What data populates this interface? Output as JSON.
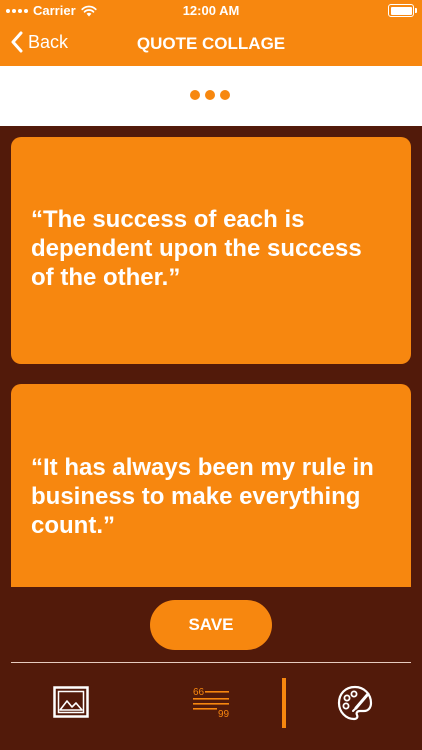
{
  "status_bar": {
    "carrier": "Carrier",
    "time": "12:00 AM"
  },
  "nav": {
    "back_label": "Back",
    "title": "QUOTE COLLAGE"
  },
  "quotes": [
    {
      "text": "“The success of each is dependent upon the success of the other.”"
    },
    {
      "text": "“It has always been my rule in business to make everything count.”"
    }
  ],
  "actions": {
    "save_label": "SAVE"
  },
  "tab_bar": {
    "items": [
      {
        "icon": "image-icon"
      },
      {
        "icon": "quote-text-icon"
      },
      {
        "icon": "palette-icon"
      }
    ]
  },
  "colors": {
    "accent": "#f7870f",
    "background": "#521a0a",
    "strip": "#ffffff"
  }
}
